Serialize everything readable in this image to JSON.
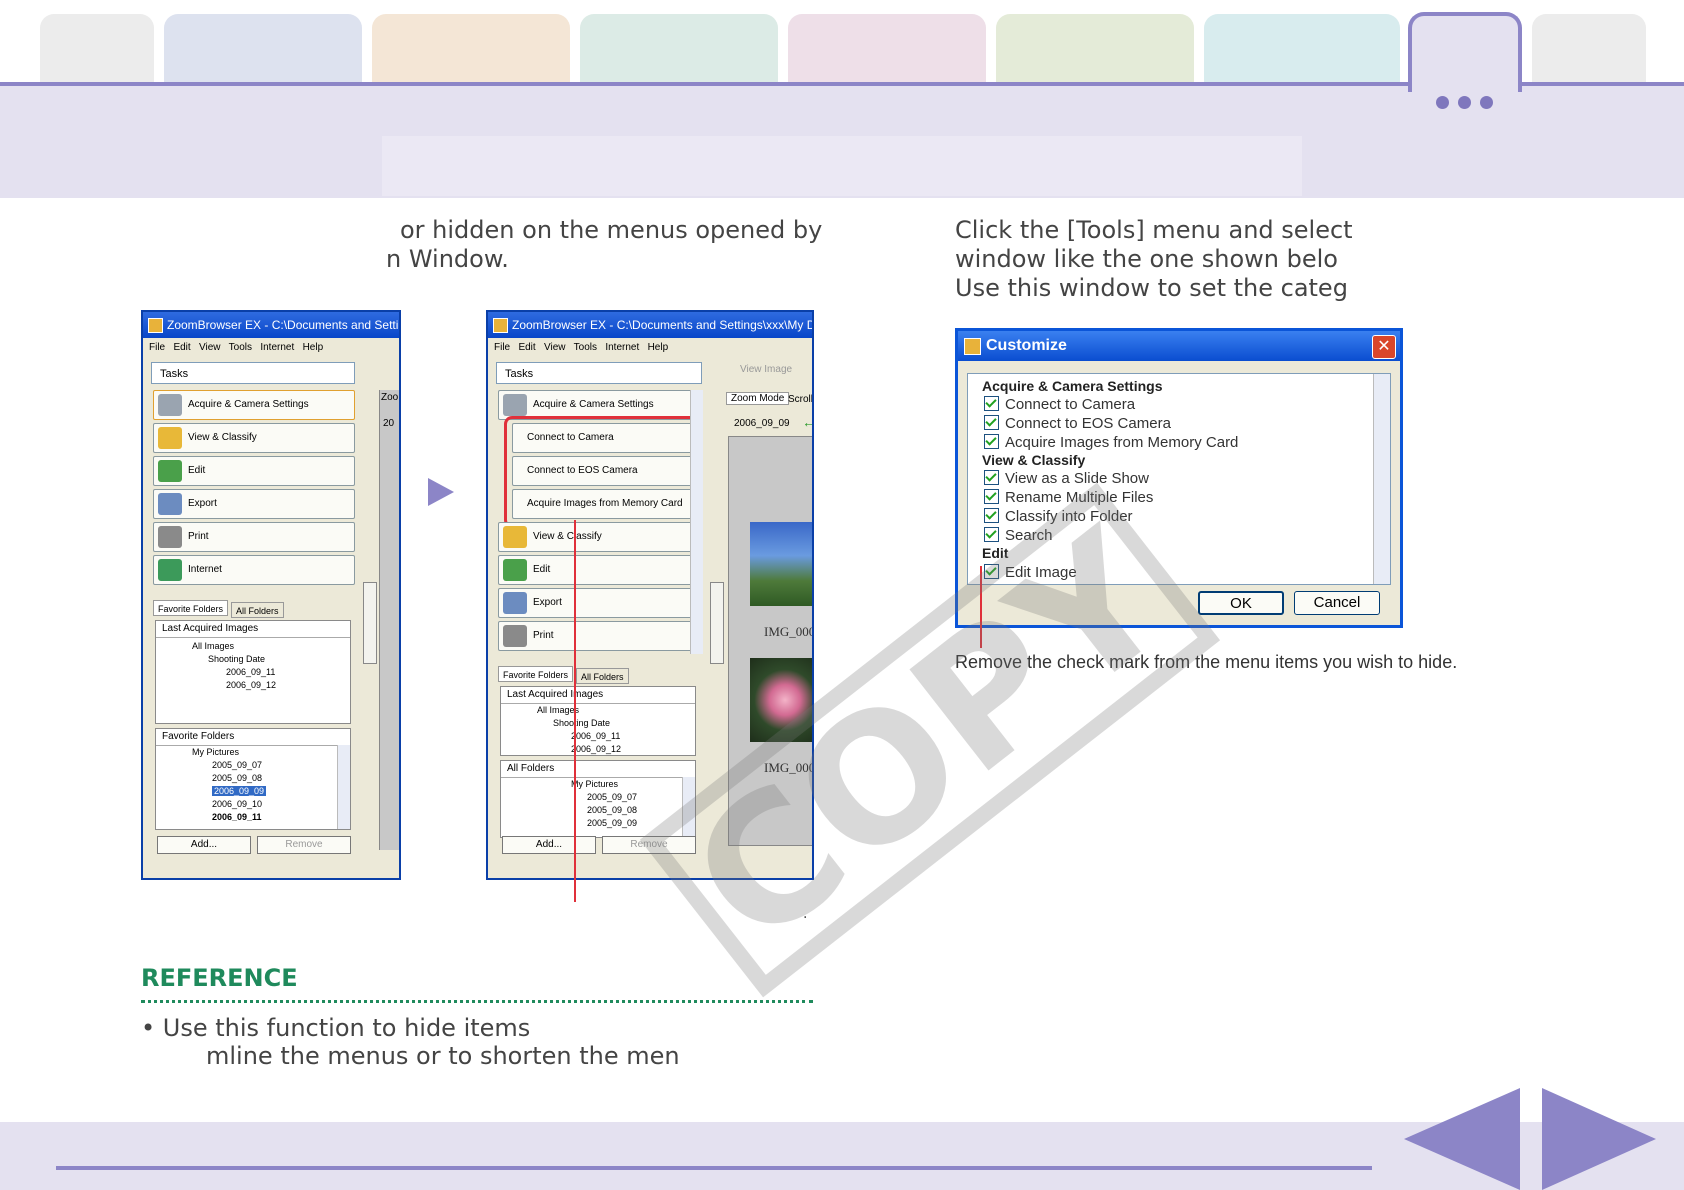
{
  "intro_text": {
    "line1": "or hidden on the menus opened by",
    "line2": "n Window."
  },
  "right_text": {
    "line1": "Click the [Tools] menu and select",
    "line2": "window like the one shown belo",
    "line3": "Use this window to set the categ"
  },
  "screenshot_left": {
    "title": "ZoomBrowser EX  -  C:\\Documents and Settin",
    "menu": "File   Edit   View   Tools   Internet   Help",
    "tasks": "Tasks",
    "buttons": [
      "Acquire & Camera Settings",
      "View & Classify",
      "Edit",
      "Export",
      "Print",
      "Internet"
    ],
    "folder_tabs": [
      "Favorite Folders",
      "All Folders"
    ],
    "last_acquired": "Last Acquired Images",
    "tree1": [
      "All Images",
      "Shooting Date",
      "2006_09_11",
      "2006_09_12"
    ],
    "favorite_folders": "Favorite Folders",
    "tree2": [
      "My Pictures",
      "2005_09_07",
      "2005_09_08",
      "2006_09_09",
      "2006_09_10",
      "2006_09_11"
    ],
    "add": "Add...",
    "remove": "Remove",
    "zoom_tab": "Zoo",
    "date_frag": "20"
  },
  "screenshot_right": {
    "title": "ZoomBrowser EX  -  C:\\Documents and Settings\\xxx\\My Do",
    "menu": "File   Edit   View   Tools   Internet   Help",
    "tasks": "Tasks",
    "acquire": "Acquire & Camera Settings",
    "sub_buttons": [
      "Connect to Camera",
      "Connect to EOS Camera",
      "Acquire Images from Memory Card"
    ],
    "buttons": [
      "View & Classify",
      "Edit",
      "Export",
      "Print"
    ],
    "folder_tabs": [
      "Favorite Folders",
      "All Folders"
    ],
    "last_acquired": "Last Acquired Images",
    "tree1": [
      "All Images",
      "Shooting Date",
      "2006_09_11",
      "2006_09_12"
    ],
    "all_folders": "All Folders",
    "tree2": [
      "My Pictures",
      "2005_09_07",
      "2005_09_08",
      "2005_09_09"
    ],
    "add": "Add...",
    "remove": "Remove",
    "view_image": "View Image",
    "zoom_mode": "Zoom Mode",
    "scroll": "Scroll",
    "date": "2006_09_09",
    "img_label1": "IMG_000",
    "img_label2": "IMG_000"
  },
  "dialog": {
    "title": "Customize",
    "close": "✕",
    "groups": [
      {
        "name": "Acquire & Camera Settings",
        "items": [
          "Connect to Camera",
          "Connect to EOS Camera",
          "Acquire Images from Memory Card"
        ]
      },
      {
        "name": "View & Classify",
        "items": [
          "View as a Slide Show",
          "Rename Multiple Files",
          "Classify into Folder",
          "Search"
        ]
      },
      {
        "name": "Edit",
        "items": [
          "Edit Image"
        ]
      }
    ],
    "ok": "OK",
    "cancel": "Cancel"
  },
  "caption": "Remove the check mark from the menu items you wish to hide.",
  "period": ".",
  "reference": {
    "title": "REFERENCE",
    "line1": "• Use this function to hide items",
    "line2": "mline the menus or to shorten the men"
  },
  "watermark": "COPY",
  "colors": {
    "accent": "#8c85c7",
    "band": "#e4e1f0",
    "reference": "#1f8a5c",
    "highlight": "#e0303a"
  }
}
